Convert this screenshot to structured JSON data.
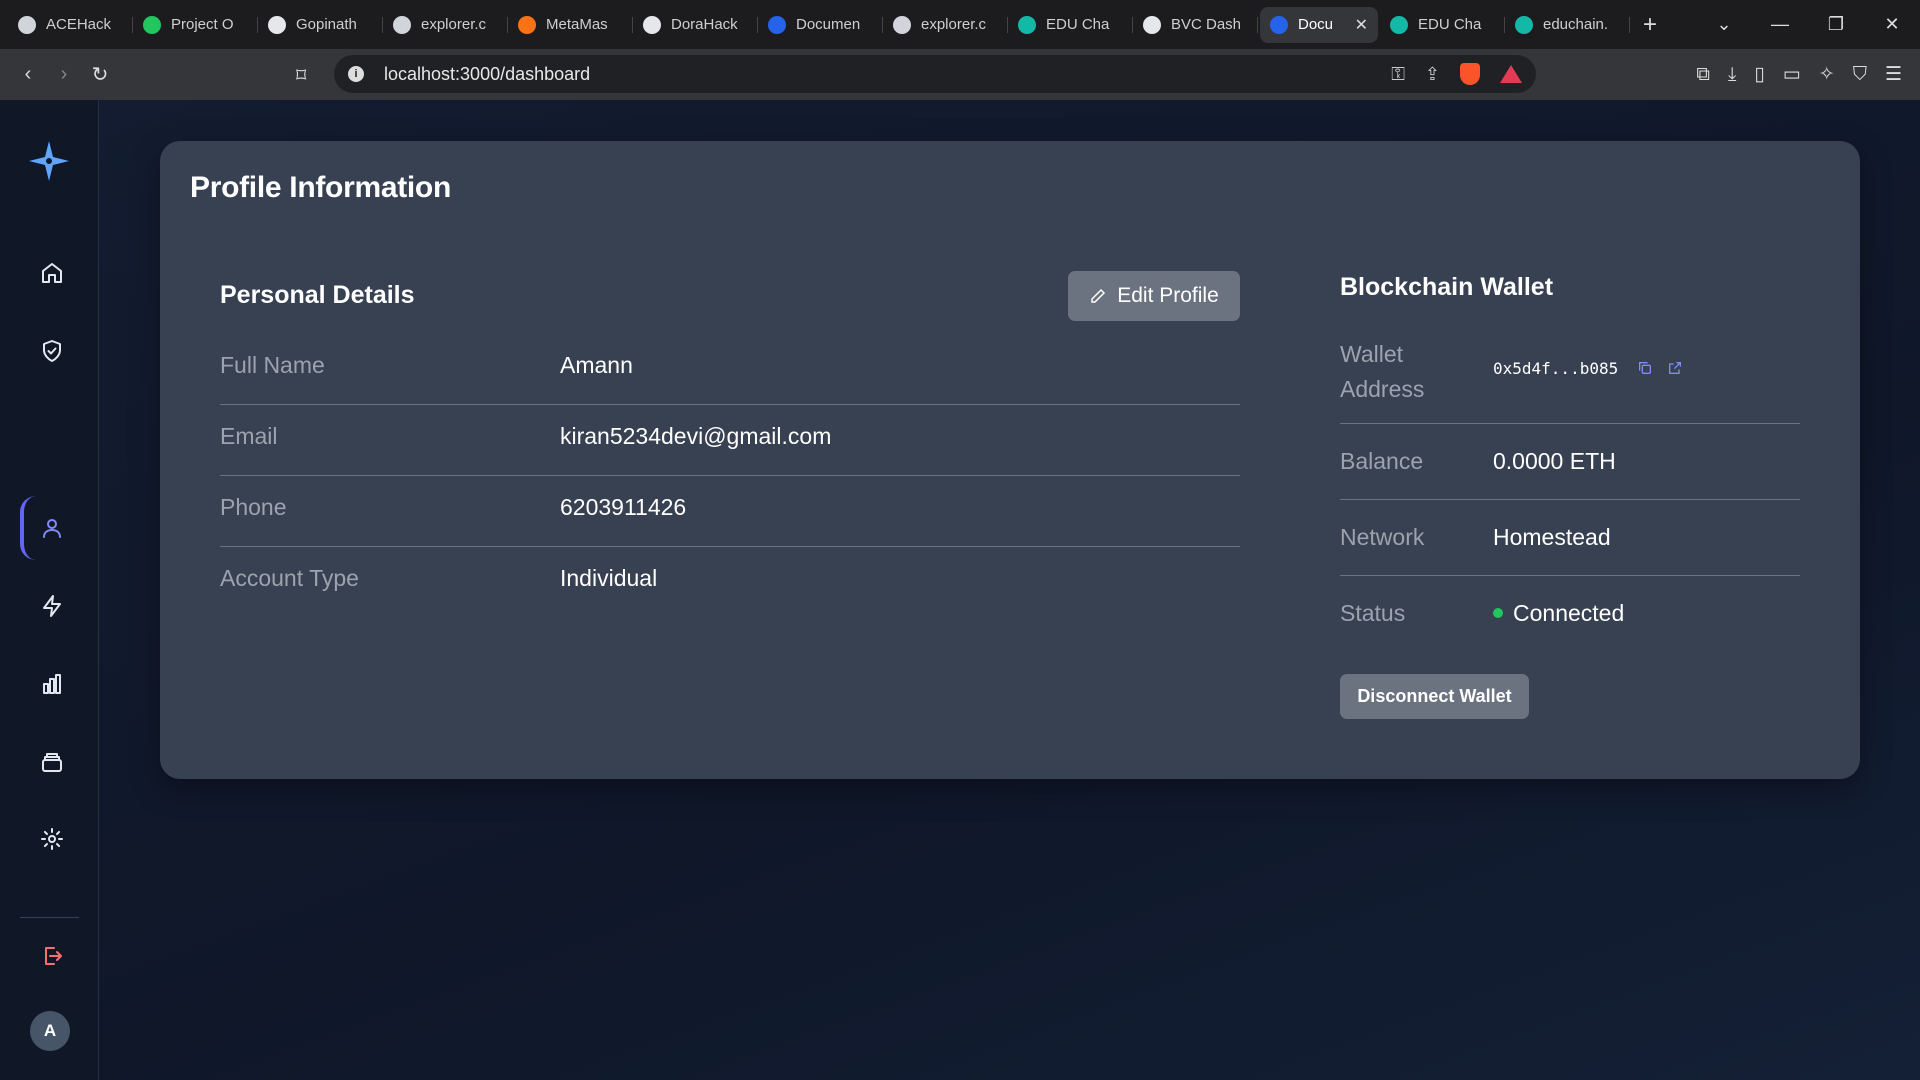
{
  "browser": {
    "tabs": [
      {
        "label": "ACEHack",
        "color": "#d1d5db"
      },
      {
        "label": "Project O",
        "color": "#22c55e"
      },
      {
        "label": "Gopinath",
        "color": "#e5e7eb"
      },
      {
        "label": "explorer.c",
        "color": "#d1d5db"
      },
      {
        "label": "MetaMas",
        "color": "#f97316"
      },
      {
        "label": "DoraHack",
        "color": "#e5e7eb"
      },
      {
        "label": "Documen",
        "color": "#2563eb"
      },
      {
        "label": "explorer.c",
        "color": "#d1d5db"
      },
      {
        "label": "EDU Cha",
        "color": "#14b8a6"
      },
      {
        "label": "BVC Dash",
        "color": "#e5e7eb"
      },
      {
        "label": "Docu",
        "color": "#2563eb",
        "active": true
      },
      {
        "label": "EDU Cha",
        "color": "#14b8a6"
      },
      {
        "label": "educhain.",
        "color": "#14b8a6"
      }
    ],
    "new_tab": "+",
    "url": "localhost:3000/dashboard"
  },
  "sidebar": {
    "avatar_initial": "A"
  },
  "profile": {
    "title": "Profile Information",
    "personal": {
      "title": "Personal Details",
      "edit_label": "Edit Profile",
      "rows": [
        {
          "label": "Full Name",
          "value": "Amann"
        },
        {
          "label": "Email",
          "value": "kiran5234devi@gmail.com"
        },
        {
          "label": "Phone",
          "value": "6203911426"
        },
        {
          "label": "Account Type",
          "value": "Individual"
        }
      ]
    },
    "wallet": {
      "title": "Blockchain Wallet",
      "address_label_1": "Wallet",
      "address_label_2": "Address",
      "address_value": "0x5d4f...b085",
      "balance_label": "Balance",
      "balance_value": "0.0000 ETH",
      "network_label": "Network",
      "network_value": "Homestead",
      "status_label": "Status",
      "status_value": "Connected",
      "status_color": "#22c55e",
      "disconnect_label": "Disconnect Wallet"
    }
  }
}
